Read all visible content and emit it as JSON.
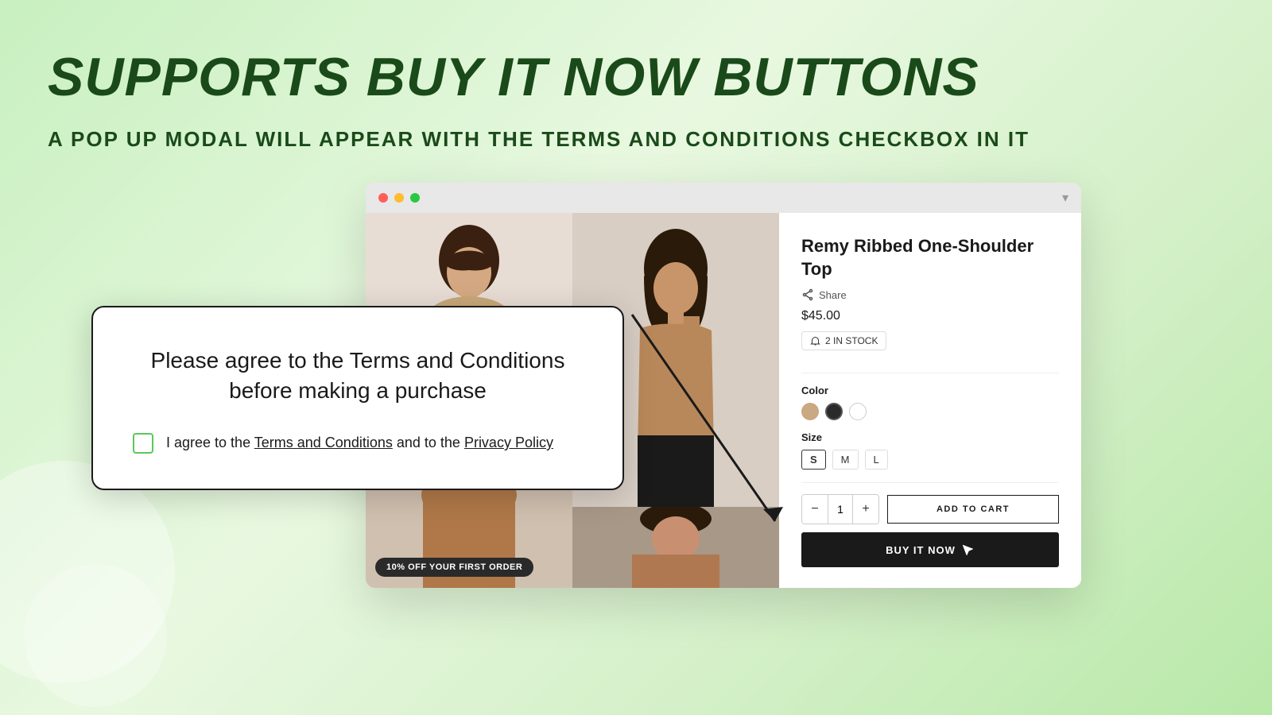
{
  "page": {
    "main_title": "SUPPORTS BUY IT NOW BUTTONS",
    "sub_title": "A POP UP MODAL WILL APPEAR WITH THE TERMS AND CONDITIONS CHECKBOX IN IT"
  },
  "browser": {
    "dots": [
      "red",
      "yellow",
      "green"
    ],
    "chevron": "▾"
  },
  "product": {
    "name": "Remy Ribbed One-Shoulder Top",
    "share_label": "Share",
    "price": "$45.00",
    "stock": "2 IN STOCK",
    "colors_label": "Color",
    "size_label": "Size",
    "sizes": [
      "S",
      "M",
      "L"
    ],
    "quantity": 1,
    "add_to_cart_label": "ADD TO CART",
    "buy_now_label": "BUY IT NOW",
    "discount_banner": "10% OFF YOUR FIRST ORDER"
  },
  "popup": {
    "title": "Please agree to the Terms and Conditions before making a purchase",
    "checkbox_text_prefix": "I agree to the ",
    "terms_link": "Terms and Conditions",
    "checkbox_text_middle": " and to the ",
    "privacy_link": "Privacy Policy"
  }
}
